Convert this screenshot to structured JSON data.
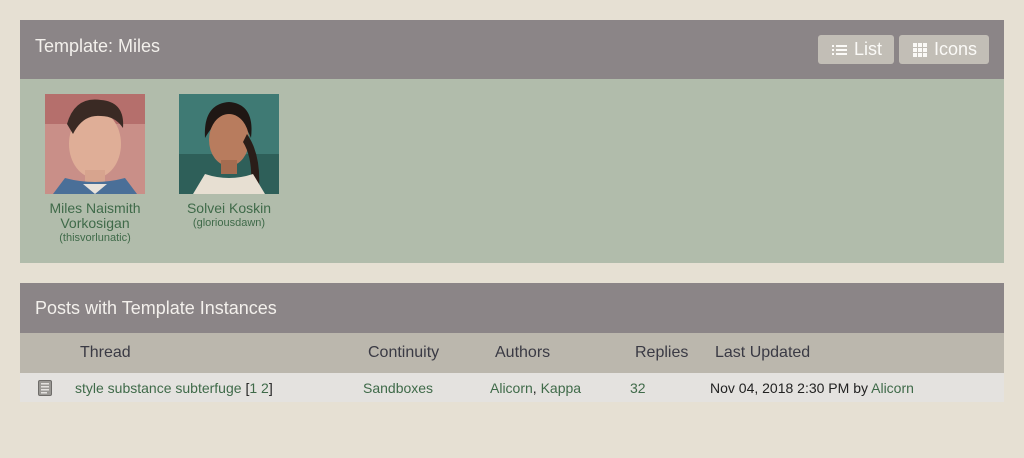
{
  "template": {
    "title": "Template: Miles",
    "view_list_label": "List",
    "view_icons_label": "Icons",
    "characters": [
      {
        "name_line1": "Miles Naismith",
        "name_line2": "Vorkosigan",
        "user": "(thisvorlunatic)"
      },
      {
        "name_line1": "Solvei Koskin",
        "name_line2": "",
        "user": "(gloriousdawn)"
      }
    ]
  },
  "posts": {
    "title": "Posts with Template Instances",
    "columns": {
      "thread": "Thread",
      "continuity": "Continuity",
      "authors": "Authors",
      "replies": "Replies",
      "last_updated": "Last Updated"
    },
    "rows": [
      {
        "thread": "style substance subterfuge",
        "page_open": "[",
        "page_1": "1",
        "page_2": "2",
        "page_close": "]",
        "continuity": "Sandboxes",
        "author_1": "Alicorn",
        "author_sep": ",",
        "author_2": "Kappa",
        "replies": "32",
        "updated_date": "Nov 04, 2018 2:30 PM",
        "updated_by_word": "by",
        "updated_by": "Alicorn"
      }
    ]
  },
  "colors": {
    "background": "#e6e0d3",
    "header": "#8b8587",
    "character_area": "#b1bcab",
    "link": "#3f6a49"
  },
  "icons": [
    "list-icon",
    "grid-icon",
    "thread-icon"
  ]
}
